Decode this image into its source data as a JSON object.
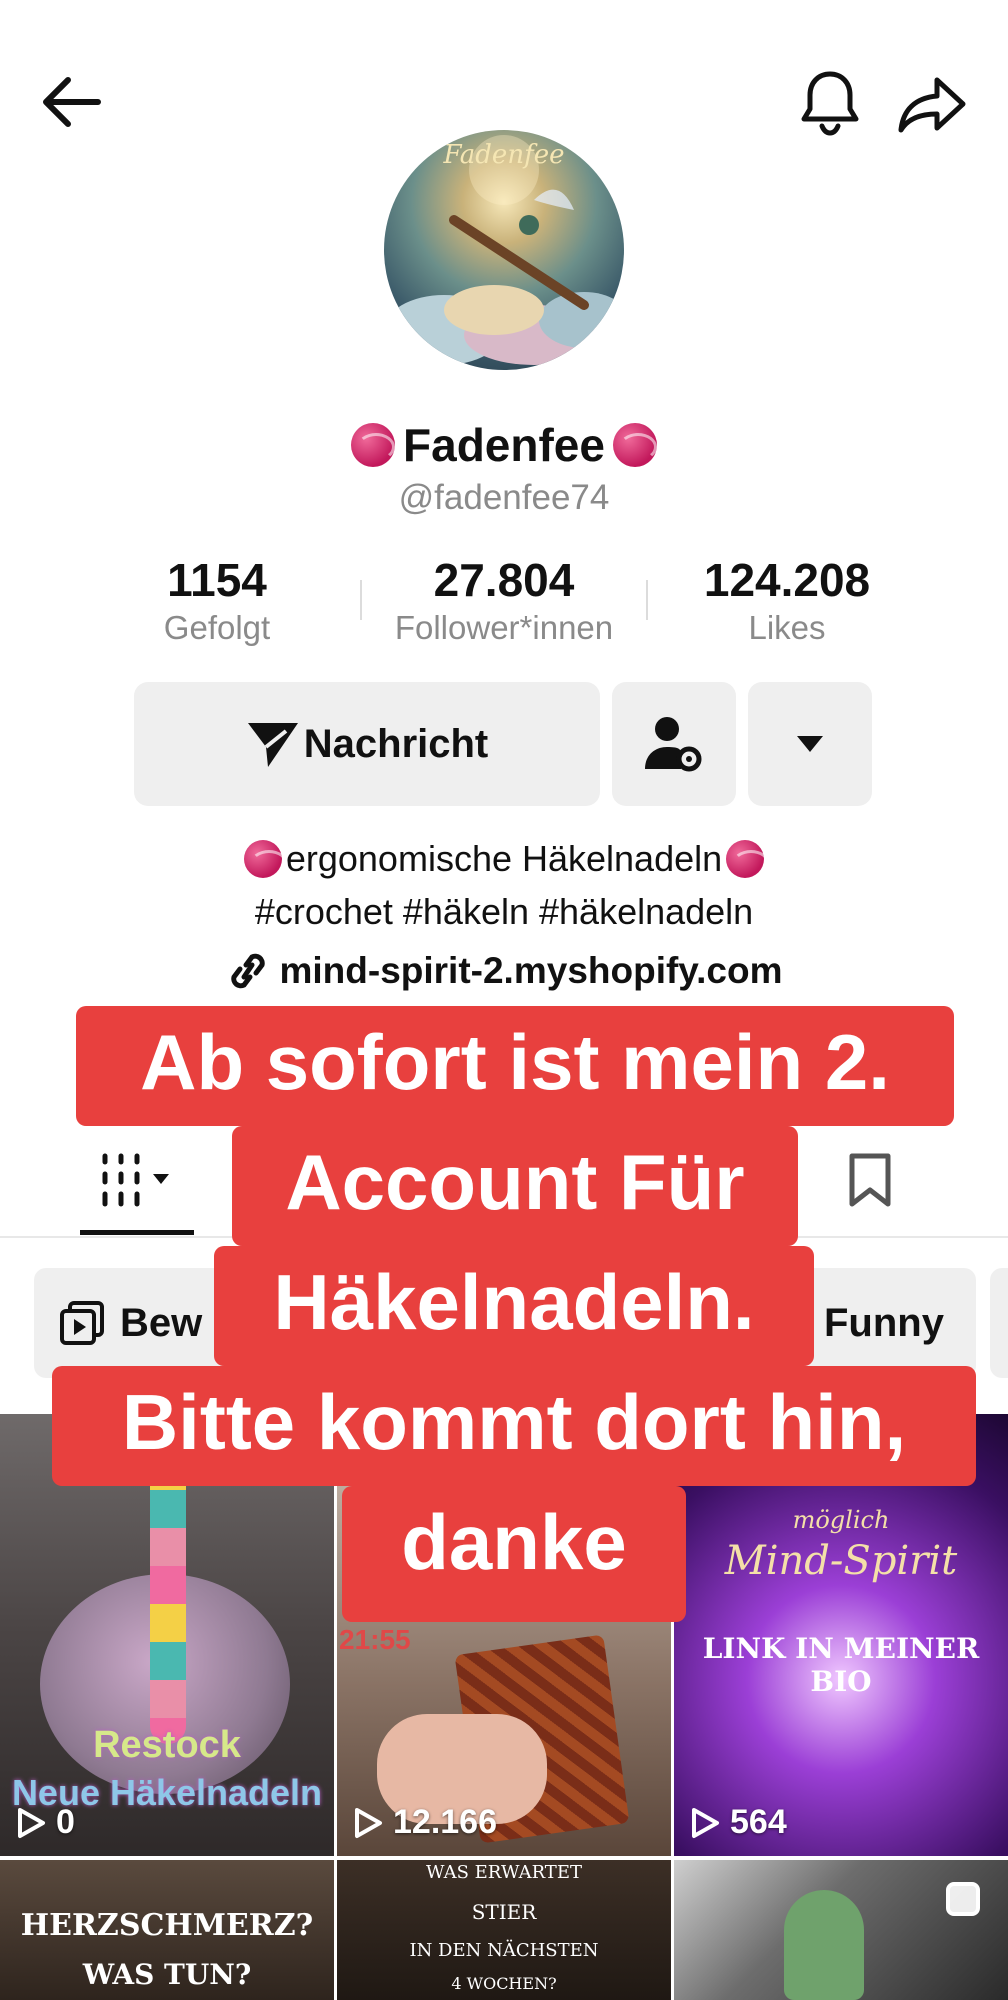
{
  "header": {
    "back_icon": "arrow-left-icon",
    "bell_icon": "bell-icon",
    "share_icon": "share-arrow-icon"
  },
  "profile": {
    "avatar_text": "Fadenfee",
    "display_name": "Fadenfee",
    "handle": "@fadenfee74",
    "stats": [
      {
        "value": "1154",
        "label": "Gefolgt"
      },
      {
        "value": "27.804",
        "label": "Follower*innen"
      },
      {
        "value": "124.208",
        "label": "Likes"
      }
    ]
  },
  "actions": {
    "message_label": "Nachricht",
    "friends_icon": "user-settings-icon",
    "more_icon": "caret-down-icon"
  },
  "bio": {
    "line1": "ergonomische Häkelnadeln",
    "line2": "#crochet #häkeln #häkelnadeln",
    "link": "mind-spirit-2.myshopify.com"
  },
  "tabs": {
    "videos_icon": "grid-icon",
    "saved_icon": "bookmark-icon"
  },
  "chips": [
    {
      "label": "Bew",
      "icon": "playlist-icon"
    },
    {
      "label": "Funny",
      "icon": ""
    }
  ],
  "overlay": {
    "lines": [
      "Ab sofort ist mein 2.",
      "Account Für",
      "Häkelnadeln.",
      "Bitte kommt dort hin,",
      "danke"
    ]
  },
  "videos": [
    {
      "views": "0",
      "caption1": "Restock",
      "caption2": "Neue Häkelnadeln"
    },
    {
      "views": "12.166",
      "time": "21:55"
    },
    {
      "views": "564",
      "caption1": "möglich",
      "caption2": "Mind-Spirit",
      "caption3": "LINK IN MEINER BIO"
    },
    {
      "caption1": "HERZSCHMERZ?",
      "caption2": "WAS TUN?"
    },
    {
      "caption1": "WAS ERWARTET",
      "caption2": "STIER",
      "caption3": "IN DEN NÄCHSTEN",
      "caption4": "4 WOCHEN?"
    },
    {}
  ],
  "colors": {
    "overlay_red": "#e8403e",
    "chip_bg": "#efefef",
    "muted_text": "#8a8a8a"
  }
}
